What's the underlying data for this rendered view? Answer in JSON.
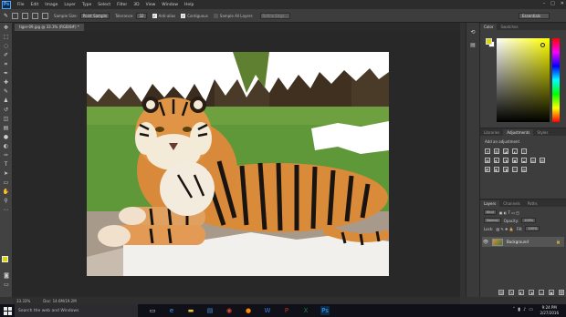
{
  "app": {
    "logo": "Ps",
    "menu": [
      "File",
      "Edit",
      "Image",
      "Layer",
      "Type",
      "Select",
      "Filter",
      "3D",
      "View",
      "Window",
      "Help"
    ],
    "window_controls": [
      "–",
      "□",
      "✕"
    ]
  },
  "options_bar": {
    "tool_icon": "brush-icon",
    "sample_size_label": "Sample Size:",
    "sample_size_value": "Point Sample",
    "tolerance_label": "Tolerance:",
    "tolerance_value": "32",
    "anti_alias_label": "Anti-alias",
    "contiguous_label": "Contiguous",
    "sample_all_layers_label": "Sample All Layers",
    "refine_edge_label": "Refine Edge...",
    "workspace_label": "Essentials"
  },
  "document": {
    "tab_title": "tiger-09.jpg @ 33.3% (RGB/8#) *",
    "zoom": "33.33%",
    "doc_info": "Doc: 14.6M/19.2M"
  },
  "panels": {
    "color_tabs": [
      "Color",
      "Swatches"
    ],
    "adjust_tabs": [
      "Libraries",
      "Adjustments",
      "Styles"
    ],
    "adjust_title": "Add an adjustment",
    "adjust_icons_row1": [
      "☀",
      "▥",
      "◪",
      "◭",
      "▽"
    ],
    "adjust_icons_row2": [
      "▦",
      "◐",
      "◑",
      "▣",
      "◒",
      "▤",
      "▧"
    ],
    "adjust_icons_row3": [
      "◩",
      "◧",
      "◨",
      "◫",
      "▨"
    ],
    "layers_tabs": [
      "Layers",
      "Channels",
      "Paths"
    ],
    "kind_label": "Kind",
    "blend_mode": "Normal",
    "opacity_label": "Opacity:",
    "opacity_value": "100%",
    "lock_label": "Lock:",
    "fill_label": "Fill:",
    "fill_value": "100%",
    "layer_name": "Background",
    "layer_footer_icons": [
      "⛓",
      "fx",
      "◐",
      "◑",
      "▭",
      "▣",
      "🗑"
    ]
  },
  "taskbar": {
    "search_placeholder": "Search the web and Windows",
    "time": "9:24 PM",
    "date": "2/27/2016"
  },
  "colors": {
    "foreground": "#d8d800",
    "background": "#ffffff",
    "accent": "#4fa6ff"
  }
}
